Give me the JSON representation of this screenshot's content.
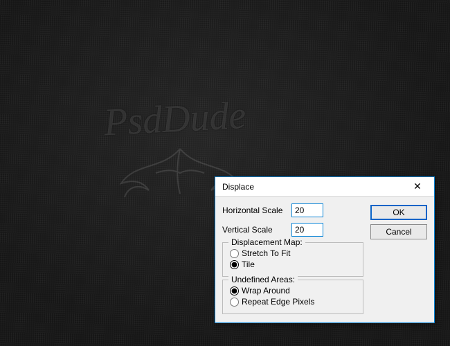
{
  "background": {
    "watermark_text": "PsdDude"
  },
  "dialog": {
    "title": "Displace",
    "fields": {
      "hscale_label": "Horizontal Scale",
      "hscale_value": "20",
      "vscale_label": "Vertical Scale",
      "vscale_value": "20"
    },
    "groups": {
      "dmap": {
        "legend": "Displacement Map:",
        "opt_stretch": "Stretch To Fit",
        "opt_tile": "Tile",
        "selected": "tile"
      },
      "undef": {
        "legend": "Undefined Areas:",
        "opt_wrap": "Wrap Around",
        "opt_repeat": "Repeat Edge Pixels",
        "selected": "wrap"
      }
    },
    "buttons": {
      "ok": "OK",
      "cancel": "Cancel"
    },
    "close_glyph": "✕"
  }
}
